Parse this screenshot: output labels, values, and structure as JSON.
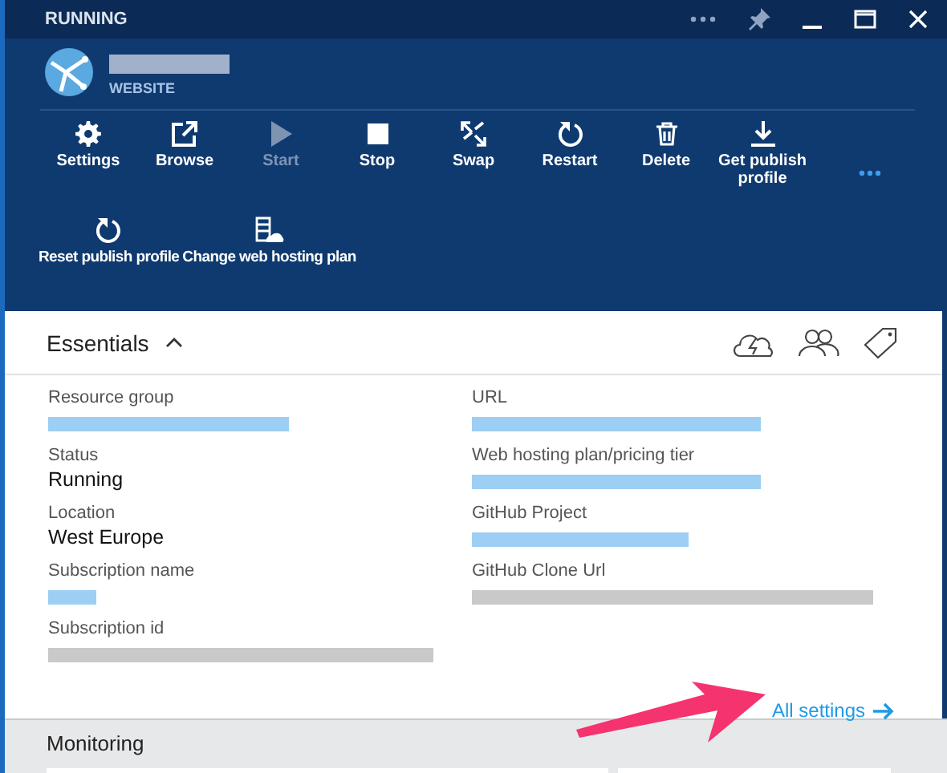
{
  "title_bar": {
    "title": "RUNNING"
  },
  "resource": {
    "name_blurred": true,
    "type": "WEBSITE"
  },
  "commands": [
    {
      "label": "Settings",
      "kind": "settings",
      "disabled": false
    },
    {
      "label": "Browse",
      "kind": "browse",
      "disabled": false
    },
    {
      "label": "Start",
      "kind": "start",
      "disabled": true
    },
    {
      "label": "Stop",
      "kind": "stop",
      "disabled": false
    },
    {
      "label": "Swap",
      "kind": "swap",
      "disabled": false
    },
    {
      "label": "Restart",
      "kind": "restart",
      "disabled": false
    },
    {
      "label": "Delete",
      "kind": "delete",
      "disabled": false
    },
    {
      "label": "Get publish profile",
      "kind": "download",
      "disabled": false
    },
    {
      "label": "Reset publish profile",
      "kind": "restart",
      "disabled": false
    },
    {
      "label": "Change web hosting plan",
      "kind": "plan",
      "disabled": false
    }
  ],
  "essentials": {
    "title": "Essentials",
    "expanded": true,
    "left": [
      {
        "label": "Resource group",
        "blurred": true,
        "kind": "link"
      },
      {
        "label": "Status",
        "value": "Running"
      },
      {
        "label": "Location",
        "value": "West Europe"
      },
      {
        "label": "Subscription name",
        "blurred": true,
        "kind": "link"
      },
      {
        "label": "Subscription id",
        "blurred": true,
        "kind": "text"
      }
    ],
    "right": [
      {
        "label": "URL",
        "blurred": true,
        "kind": "link"
      },
      {
        "label": "Web hosting plan/pricing tier",
        "blurred": true,
        "kind": "link"
      },
      {
        "label": "GitHub Project",
        "blurred": true,
        "kind": "link"
      },
      {
        "label": "GitHub Clone Url",
        "blurred": true,
        "kind": "text"
      }
    ],
    "link": "All settings"
  },
  "monitoring": {
    "title": "Monitoring"
  }
}
